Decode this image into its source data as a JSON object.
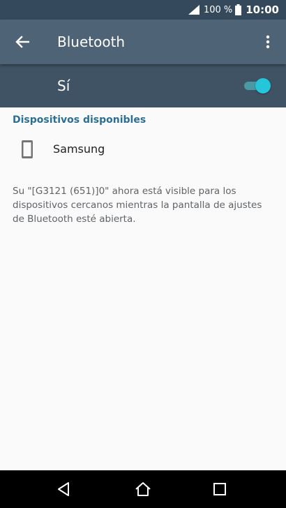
{
  "status_bar": {
    "battery_percent": "100 %",
    "time": "10:00"
  },
  "app_bar": {
    "title": "Bluetooth",
    "back_icon": "arrow-back-icon",
    "more_icon": "more-vert-icon"
  },
  "master_switch": {
    "label": "Sí",
    "state": true,
    "accent_color": "#26c6da"
  },
  "available_devices": {
    "header": "Dispositivos disponibles",
    "items": [
      {
        "name": "Samsung",
        "icon": "smartphone-icon"
      }
    ]
  },
  "visibility_info": "Su \"[G3121 (651)]0\" ahora está visible para los dispositivos cercanos mientras la pantalla de ajustes de Bluetooth esté abierta.",
  "colors": {
    "status_bar": "#34495b",
    "app_bar": "#4f6376",
    "switch_bar": "#3f5365",
    "section_header": "#2c6e94"
  },
  "nav_bar": {
    "back_icon": "nav-back-icon",
    "home_icon": "nav-home-icon",
    "recents_icon": "nav-recents-icon"
  }
}
